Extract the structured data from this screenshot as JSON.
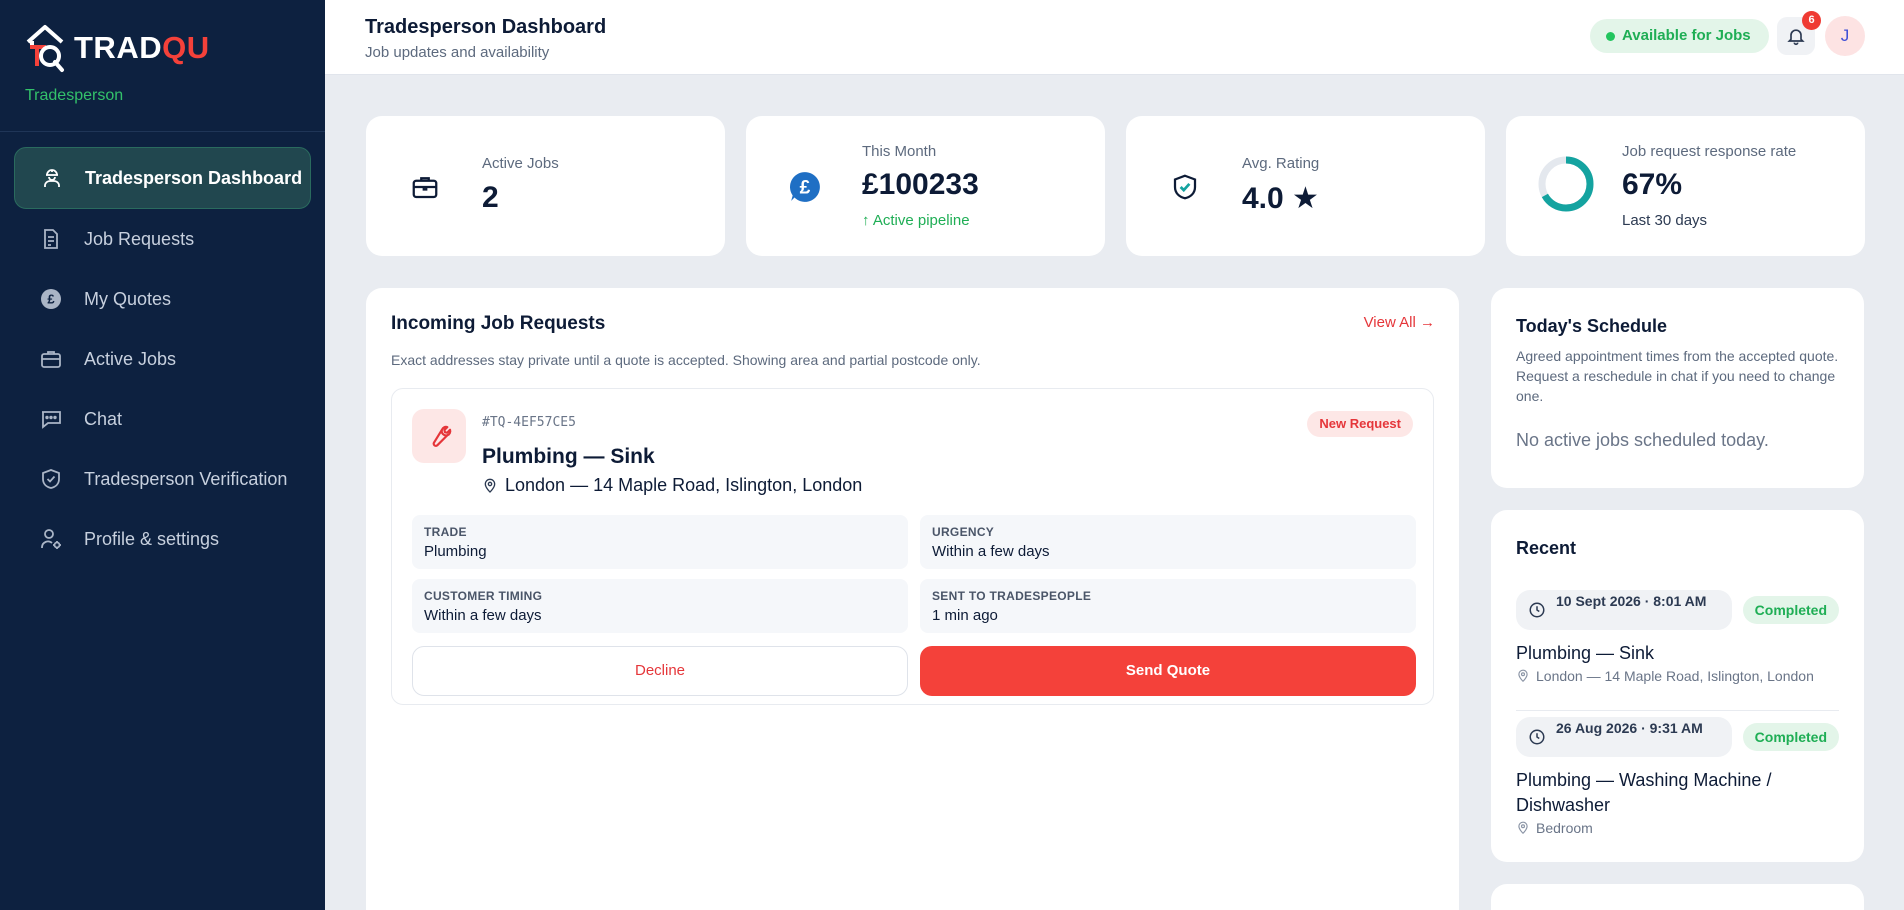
{
  "brand": {
    "name_part1": "TRAD",
    "name_part2": "QU",
    "role": "Tradesperson"
  },
  "sidebar": {
    "items": [
      {
        "label": "Tradesperson Dashboard",
        "icon": "worker-icon",
        "active": true
      },
      {
        "label": "Job Requests",
        "icon": "document-icon"
      },
      {
        "label": "My Quotes",
        "icon": "pound-coin-icon"
      },
      {
        "label": "Active Jobs",
        "icon": "briefcase-icon"
      },
      {
        "label": "Chat",
        "icon": "chat-icon"
      },
      {
        "label": "Tradesperson Verification",
        "icon": "shield-check-icon"
      },
      {
        "label": "Profile & settings",
        "icon": "user-gear-icon"
      }
    ]
  },
  "header": {
    "title": "Tradesperson Dashboard",
    "subtitle": "Job updates and availability",
    "availability": "Available for Jobs",
    "notification_count": "6",
    "avatar_initial": "J"
  },
  "stats": {
    "active_jobs": {
      "label": "Active Jobs",
      "value": "2"
    },
    "this_month": {
      "label": "This Month",
      "value": "£100233",
      "foot": "↑ Active pipeline"
    },
    "rating": {
      "label": "Avg. Rating",
      "value": "4.0 ★"
    },
    "response": {
      "label": "Job request response rate",
      "value": "67%",
      "foot": "Last 30 days",
      "fraction": 0.67
    }
  },
  "incoming": {
    "title": "Incoming Job Requests",
    "view_all": "View All →",
    "description": "Exact addresses stay private until a quote is accepted. Showing area and partial postcode only.",
    "job": {
      "ref": "#TQ-4EF57CE5",
      "tag": "New Request",
      "title": "Plumbing — Sink",
      "location": "London — 14 Maple Road, Islington, London",
      "fields": [
        {
          "label": "Trade",
          "value": "Plumbing"
        },
        {
          "label": "Urgency",
          "value": "Within a few days"
        },
        {
          "label": "Customer Timing",
          "value": "Within a few days"
        },
        {
          "label": "Sent to Tradespeople",
          "value": "1 min ago"
        }
      ],
      "decline": "Decline",
      "send_quote": "Send Quote"
    }
  },
  "schedule": {
    "title": "Today's Schedule",
    "description": "Agreed appointment times from the accepted quote. Request a reschedule in chat if you need to change one.",
    "empty": "No active jobs scheduled today."
  },
  "recent": {
    "title": "Recent",
    "items": [
      {
        "date": "10 Sept 2026 · 8:01 AM",
        "status": "Completed",
        "name": "Plumbing — Sink",
        "location": "London — 14 Maple Road, Islington, London"
      },
      {
        "date": "26 Aug 2026 · 9:31 AM",
        "status": "Completed",
        "name": "Plumbing — Washing Machine / Dishwasher",
        "location": "Bedroom"
      }
    ]
  },
  "colors": {
    "accent": "#f4413a",
    "sidebar": "#0d2140",
    "success": "#22c55e",
    "teal": "#14a3a0"
  }
}
